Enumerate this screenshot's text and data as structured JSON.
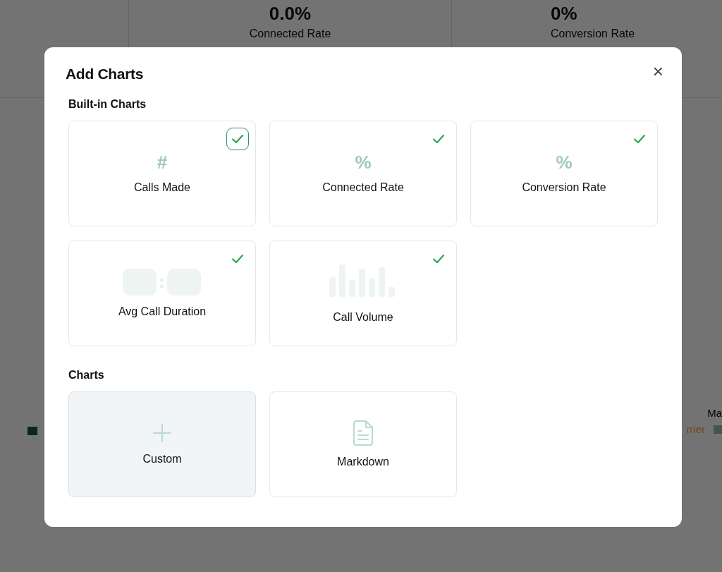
{
  "background": {
    "stats": [
      {
        "value": "0.0%",
        "label": "Connected Rate"
      },
      {
        "value": "0%",
        "label": "Conversion Rate"
      }
    ],
    "legend_fragments": [
      {
        "text": "Ma",
        "kind": "plain"
      },
      {
        "text": "rrier",
        "kind": "orange"
      }
    ]
  },
  "dialog": {
    "title": "Add Charts",
    "close": "×",
    "sections": [
      {
        "title": "Built-in Charts",
        "cards": [
          {
            "label": "Calls Made",
            "kind": "hash",
            "glyph": "#",
            "checked": true,
            "focused": true
          },
          {
            "label": "Connected Rate",
            "kind": "percent",
            "glyph": "%",
            "checked": true,
            "focused": false
          },
          {
            "label": "Conversion Rate",
            "kind": "percent",
            "glyph": "%",
            "checked": true,
            "focused": false
          },
          {
            "label": "Avg Call Duration",
            "kind": "duration",
            "checked": true,
            "focused": false
          },
          {
            "label": "Call Volume",
            "kind": "bars",
            "checked": true,
            "focused": false
          }
        ]
      },
      {
        "title": "Charts",
        "cards": [
          {
            "label": "Custom",
            "kind": "plus",
            "hovered": true
          },
          {
            "label": "Markdown",
            "kind": "document",
            "hovered": false
          }
        ]
      }
    ]
  }
}
